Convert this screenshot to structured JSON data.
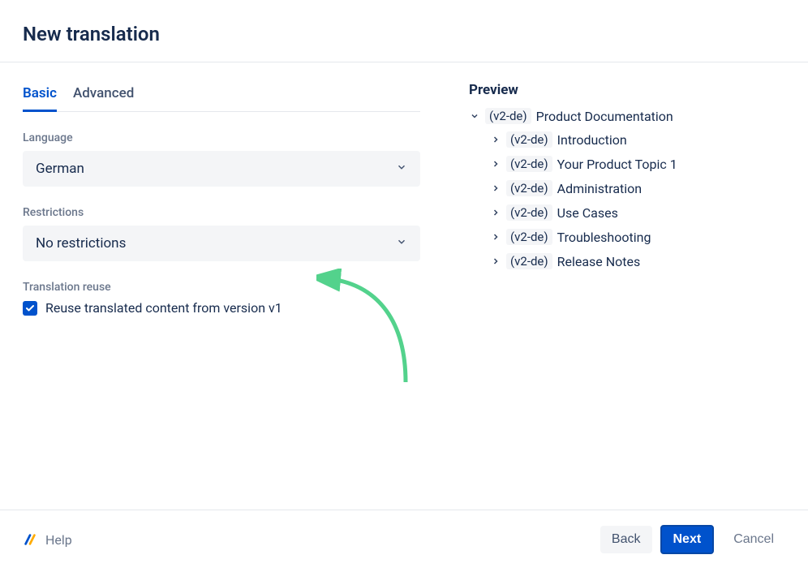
{
  "header": {
    "title": "New translation"
  },
  "tabs": {
    "basic": "Basic",
    "advanced": "Advanced"
  },
  "form": {
    "language_label": "Language",
    "language_value": "German",
    "restrictions_label": "Restrictions",
    "restrictions_value": "No restrictions",
    "reuse_label": "Translation reuse",
    "reuse_checkbox_label": "Reuse translated content from version v1"
  },
  "preview": {
    "title": "Preview",
    "root": {
      "badge": "(v2-de)",
      "label": "Product Documentation"
    },
    "children": [
      {
        "badge": "(v2-de)",
        "label": "Introduction"
      },
      {
        "badge": "(v2-de)",
        "label": "Your Product Topic 1"
      },
      {
        "badge": "(v2-de)",
        "label": "Administration"
      },
      {
        "badge": "(v2-de)",
        "label": "Use Cases"
      },
      {
        "badge": "(v2-de)",
        "label": "Troubleshooting"
      },
      {
        "badge": "(v2-de)",
        "label": "Release Notes"
      }
    ]
  },
  "footer": {
    "help": "Help",
    "back": "Back",
    "next": "Next",
    "cancel": "Cancel"
  }
}
